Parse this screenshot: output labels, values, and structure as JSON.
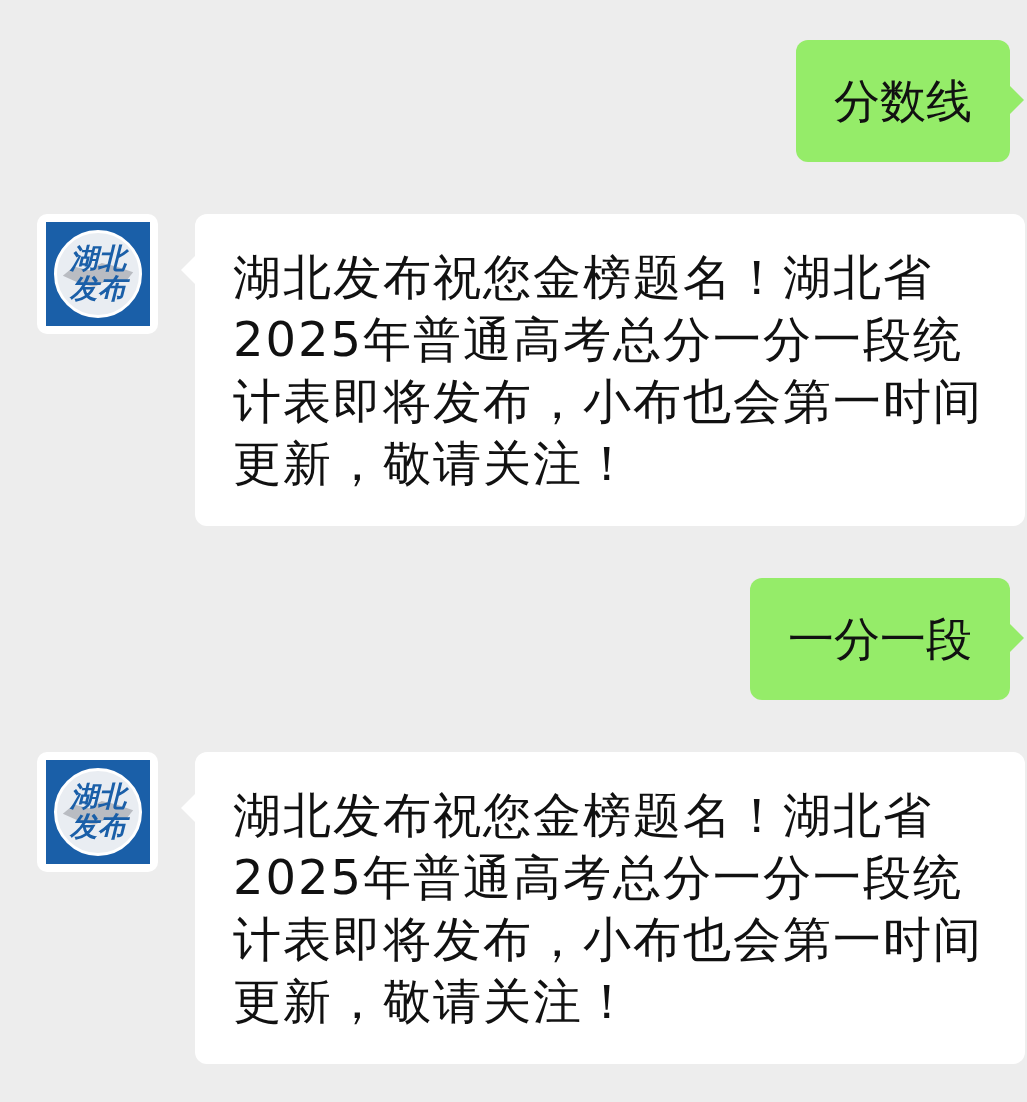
{
  "messages": [
    {
      "kind": "sent",
      "text": "分数线"
    },
    {
      "kind": "received",
      "avatar": {
        "logo_lines": [
          "湖北",
          "发布"
        ]
      },
      "text": "湖北发布祝您金榜题名！湖北省2025年普通高考总分一分一段统计表即将发布，小布也会第一时间更新，敬请关注！"
    },
    {
      "kind": "sent",
      "text": "一分一段"
    },
    {
      "kind": "received",
      "avatar": {
        "logo_lines": [
          "湖北",
          "发布"
        ]
      },
      "text": "湖北发布祝您金榜题名！湖北省2025年普通高考总分一分一段统计表即将发布，小布也会第一时间更新，敬请关注！"
    }
  ]
}
